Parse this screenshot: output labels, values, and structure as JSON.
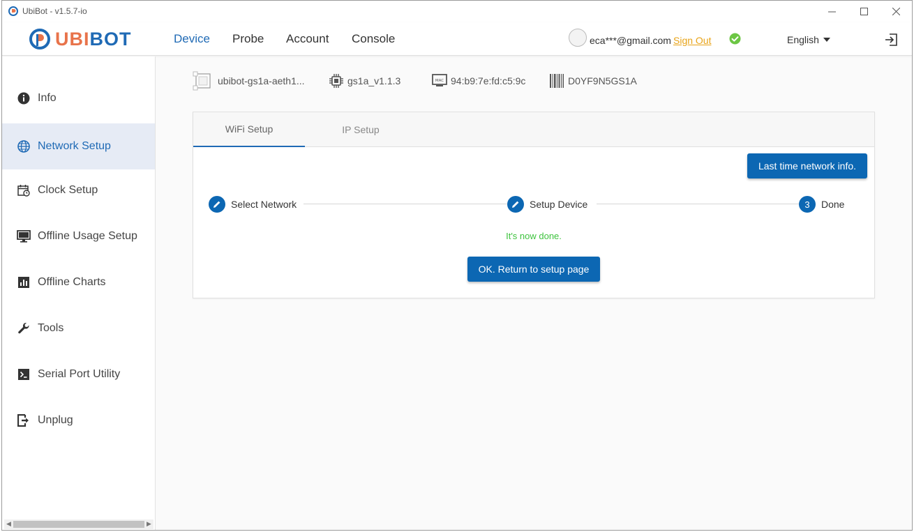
{
  "window": {
    "title": "UbiBot - v1.5.7-io"
  },
  "appbar": {
    "logo_ubi": "UBI",
    "logo_bot": "BOT",
    "nav": [
      {
        "label": "Device",
        "active": true
      },
      {
        "label": "Probe",
        "active": false
      },
      {
        "label": "Account",
        "active": false
      },
      {
        "label": "Console",
        "active": false
      }
    ],
    "user_email": "eca***@gmail.com",
    "sign_out_label": "Sign Out",
    "language": "English"
  },
  "sidebar": {
    "items": [
      {
        "label": "Info",
        "icon": "info-icon"
      },
      {
        "label": "Network Setup",
        "icon": "globe-icon",
        "active": true
      },
      {
        "label": "Clock Setup",
        "icon": "calendar-clock-icon"
      },
      {
        "label": "Offline Usage Setup",
        "icon": "monitor-icon"
      },
      {
        "label": "Offline Charts",
        "icon": "bar-chart-icon"
      },
      {
        "label": "Tools",
        "icon": "wrench-icon"
      },
      {
        "label": "Serial Port Utility",
        "icon": "terminal-icon"
      },
      {
        "label": "Unplug",
        "icon": "unplug-icon"
      }
    ]
  },
  "device": {
    "name": "ubibot-gs1a-aeth1...",
    "firmware": "gs1a_v1.1.3",
    "mac": "94:b9:7e:fd:c5:9c",
    "serial": "D0YF9N5GS1A",
    "mac_badge": "MAC"
  },
  "setup": {
    "tabs": [
      {
        "label": "WiFi Setup",
        "active": true
      },
      {
        "label": "IP Setup",
        "active": false
      }
    ],
    "last_network_button": "Last time network info.",
    "steps": [
      {
        "label": "Select Network",
        "state": "completed"
      },
      {
        "label": "Setup Device",
        "state": "completed"
      },
      {
        "label": "Done",
        "state": "current",
        "number": "3"
      }
    ],
    "done_message": "It's now done.",
    "return_button": "OK. Return to setup page"
  },
  "colors": {
    "primary": "#0c67b3",
    "brand_orange": "#e8734a",
    "sign_out": "#e8a317",
    "success_text": "#3ec33e",
    "sidebar_active_bg": "#e6ebf5"
  }
}
